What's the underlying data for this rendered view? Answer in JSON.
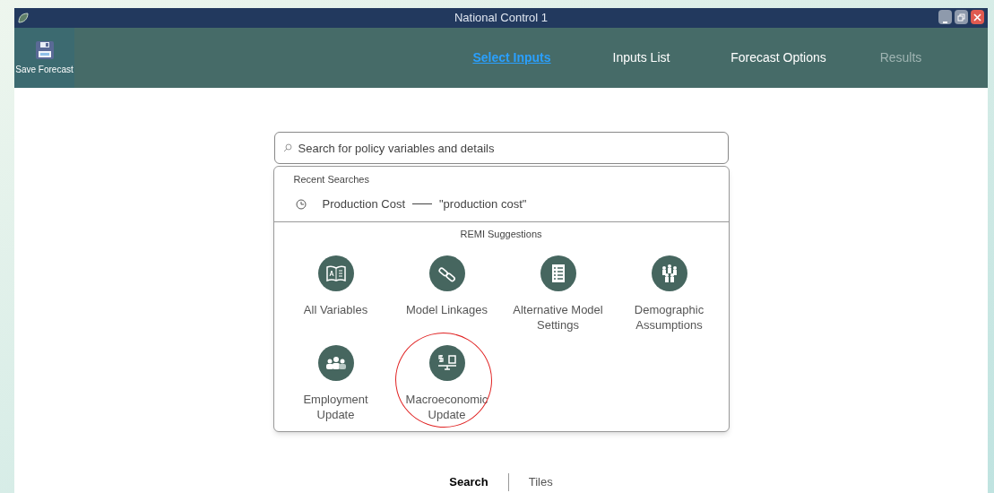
{
  "window": {
    "title": "National Control 1"
  },
  "toolbar": {
    "save_button": "Save Forecast"
  },
  "tabs": [
    {
      "label": "Select Inputs",
      "selected": true,
      "disabled": false
    },
    {
      "label": "Inputs List",
      "selected": false,
      "disabled": false
    },
    {
      "label": "Forecast Options",
      "selected": false,
      "disabled": false
    },
    {
      "label": "Results",
      "selected": false,
      "disabled": true
    }
  ],
  "search": {
    "placeholder": "Search for policy variables and details"
  },
  "recent_searches": {
    "heading": "Recent Searches",
    "items": [
      {
        "label": "Production Cost",
        "query": "\"production cost\""
      }
    ]
  },
  "suggestions": {
    "heading": "REMI Suggestions",
    "items": [
      {
        "kind": "book",
        "label": "All Variables",
        "circled": false
      },
      {
        "kind": "link",
        "label": "Model Linkages",
        "circled": false
      },
      {
        "kind": "list",
        "label": "Alternative Model Settings",
        "circled": false
      },
      {
        "kind": "crowd",
        "label": "Demographic Assumptions",
        "circled": false
      },
      {
        "kind": "people",
        "label": "Employment Update",
        "circled": false
      },
      {
        "kind": "money",
        "label": "Macroeconomic Update",
        "circled": true
      }
    ]
  },
  "view_toggle": [
    {
      "label": "Search",
      "selected": true
    },
    {
      "label": "Tiles",
      "selected": false
    }
  ]
}
